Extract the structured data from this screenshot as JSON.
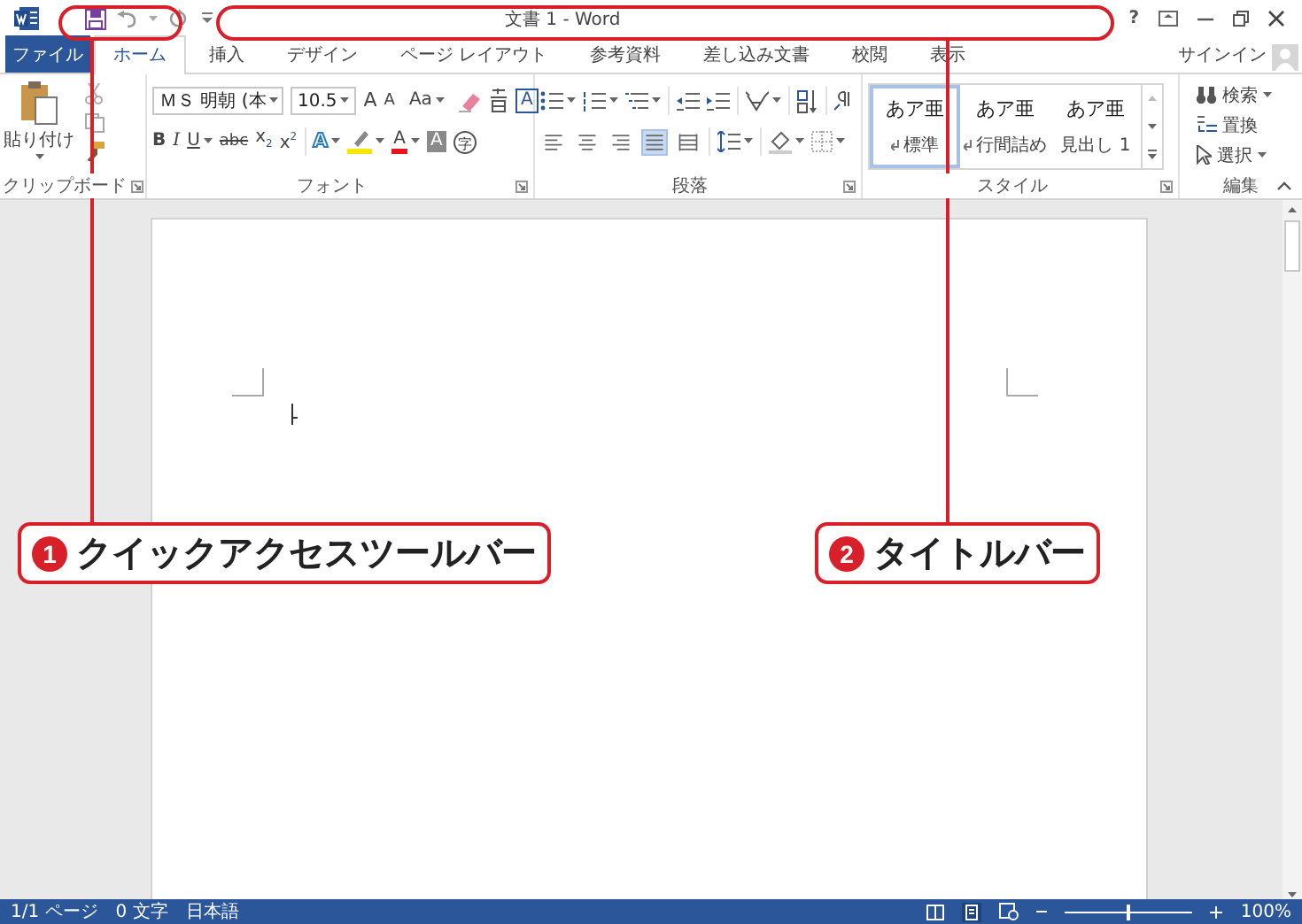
{
  "window": {
    "title": "文書 1 - Word",
    "help": "?"
  },
  "tabs": [
    {
      "label": "ファイル",
      "kind": "file",
      "selected": false
    },
    {
      "label": "ホーム",
      "kind": "tab",
      "selected": true
    },
    {
      "label": "挿入",
      "kind": "tab",
      "selected": false
    },
    {
      "label": "デザイン",
      "kind": "tab",
      "selected": false
    },
    {
      "label": "ページ レイアウト",
      "kind": "tab",
      "selected": false
    },
    {
      "label": "参考資料",
      "kind": "tab",
      "selected": false
    },
    {
      "label": "差し込み文書",
      "kind": "tab",
      "selected": false
    },
    {
      "label": "校閲",
      "kind": "tab",
      "selected": false
    },
    {
      "label": "表示",
      "kind": "tab",
      "selected": false
    }
  ],
  "account": {
    "label": "サインイン"
  },
  "ribbon": {
    "clipboard": {
      "paste": "貼り付け",
      "label": "クリップボード",
      "launcher": true
    },
    "font": {
      "label": "フォント",
      "launcher": true,
      "row_1": [
        {
          "kind": "font-field",
          "label": "ＭＳ 明朝 (本",
          "caret": true
        },
        {
          "kind": "size-field",
          "label": "10.5",
          "caret": true
        },
        {
          "kind": "grow",
          "label": "A",
          "caret": false
        },
        {
          "kind": "shrink",
          "label": "A",
          "caret": false
        },
        {
          "kind": "menu",
          "label": "Aa",
          "caret": true
        },
        {
          "kind": "eraser",
          "caret": false
        },
        {
          "kind": "ruby",
          "caret": false
        },
        {
          "kind": "boxed",
          "label": "A",
          "caret": false
        }
      ],
      "row_2": [
        {
          "kind": "bold",
          "label": "B",
          "caret": false
        },
        {
          "kind": "italic",
          "label": "I",
          "caret": false
        },
        {
          "kind": "underline",
          "label": "U",
          "caret": true
        },
        {
          "kind": "strike",
          "label": "abc",
          "caret": false
        },
        {
          "kind": "plain",
          "label": "x$_{2}$",
          "caret": false
        },
        {
          "kind": "plain",
          "label": "x$^{2}$",
          "caret": false
        },
        {
          "kind": "effects",
          "label": "A",
          "caret": true
        },
        {
          "kind": "highlight",
          "caret": true
        },
        {
          "kind": "color",
          "label": "A",
          "caret": true
        },
        {
          "kind": "shaded",
          "label": "A",
          "caret": false
        },
        {
          "kind": "circled",
          "label": "字",
          "caret": false
        }
      ]
    },
    "paragraph": {
      "label": "段落",
      "launcher": true,
      "alignments": [
        {
          "selected": false
        },
        {
          "selected": false
        },
        {
          "selected": false
        },
        {
          "selected": true
        },
        {
          "selected": false
        }
      ]
    },
    "styles": {
      "label": "スタイル",
      "launcher": true,
      "items": [
        {
          "preview": "あア亜",
          "name": "標準",
          "mark": true,
          "selected": true
        },
        {
          "preview": "あア亜",
          "name": "行間詰め",
          "mark": true,
          "selected": false
        },
        {
          "preview": "あア亜",
          "name": "見出し 1",
          "mark": false,
          "selected": false
        }
      ]
    },
    "editing": {
      "label": "編集",
      "launcher": false,
      "items": [
        {
          "label": "検索",
          "caret": true
        },
        {
          "label": "置換",
          "caret": false
        },
        {
          "label": "選択",
          "caret": true
        }
      ]
    }
  },
  "status_bar": {
    "pages": "1/1 ページ",
    "words": "0 文字",
    "language": "日本語",
    "zoom": "100%",
    "zoom_slider": {
      "level": 0.5
    }
  },
  "callouts": [
    {
      "number": "1",
      "label": "クイックアクセスツールバー"
    },
    {
      "number": "2",
      "label": "タイトルバー"
    }
  ]
}
